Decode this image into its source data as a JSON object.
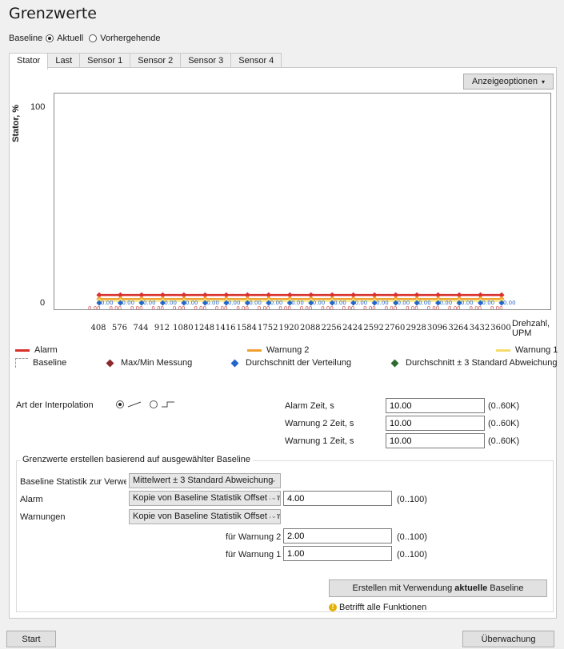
{
  "title": "Grenzwerte",
  "baseline": {
    "label": "Baseline",
    "option_current": "Aktuell",
    "option_previous": "Vorhergehende",
    "selected": "Aktuell"
  },
  "tabs": [
    "Stator",
    "Last",
    "Sensor 1",
    "Sensor 2",
    "Sensor 3",
    "Sensor 4"
  ],
  "active_tab": "Stator",
  "display_options_label": "Anzeigeoptionen",
  "chart_data": {
    "type": "line",
    "ylabel": "Stator, %",
    "xlabel": "Drehzahl, UPM",
    "yticks": [
      "100",
      "0"
    ],
    "ylim": [
      0,
      100
    ],
    "categories": [
      "408",
      "576",
      "744",
      "912",
      "1080",
      "1248",
      "1416",
      "1584",
      "1752",
      "1920",
      "2088",
      "2256",
      "2424",
      "2592",
      "2760",
      "2928",
      "3096",
      "3264",
      "3432",
      "3600"
    ],
    "series": [
      {
        "name": "Alarm",
        "color": "#d9302b",
        "values": [
          4,
          4,
          4,
          4,
          4,
          4,
          4,
          4,
          4,
          4,
          4,
          4,
          4,
          4,
          4,
          4,
          4,
          4,
          4,
          4
        ]
      },
      {
        "name": "Warnung 2",
        "color": "#f0a030",
        "values": [
          2,
          2,
          2,
          2,
          2,
          2,
          2,
          2,
          2,
          2,
          2,
          2,
          2,
          2,
          2,
          2,
          2,
          2,
          2,
          2
        ]
      },
      {
        "name": "Warnung 1",
        "color": "#f5dc6a",
        "values": [
          1,
          1,
          1,
          1,
          1,
          1,
          1,
          1,
          1,
          1,
          1,
          1,
          1,
          1,
          1,
          1,
          1,
          1,
          1,
          1
        ]
      },
      {
        "name": "Durchschnitt der Verteilung",
        "color": "#2266cc",
        "values": [
          0,
          0,
          0,
          0,
          0,
          0,
          0,
          0,
          0,
          0,
          0,
          0,
          0,
          0,
          0,
          0,
          0,
          0,
          0,
          0
        ]
      }
    ],
    "point_labels_blue": "0.00",
    "point_labels_red": "0.00",
    "legend": [
      {
        "name": "Alarm",
        "kind": "line",
        "color": "#d9302b"
      },
      {
        "name": "Warnung 2",
        "kind": "line",
        "color": "#f0a030"
      },
      {
        "name": "Warnung 1",
        "kind": "line",
        "color": "#f5dc6a"
      },
      {
        "name": "Baseline",
        "kind": "dashed",
        "color": "#999999"
      },
      {
        "name": "Max/Min Messung",
        "kind": "diamond",
        "color": "#8b2a2a"
      },
      {
        "name": "Durchschnitt der Verteilung",
        "kind": "diamond",
        "color": "#2266cc"
      },
      {
        "name": "Durchschnitt ± 3 Standard Abweichung",
        "kind": "diamond",
        "color": "#2e6b2e"
      }
    ]
  },
  "interpolation": {
    "label": "Art der Interpolation"
  },
  "times": [
    {
      "label": "Alarm Zeit, s",
      "value": "10.00",
      "range": "(0..60K)"
    },
    {
      "label": "Warnung 2 Zeit, s",
      "value": "10.00",
      "range": "(0..60K)"
    },
    {
      "label": "Warnung 1 Zeit, s",
      "value": "10.00",
      "range": "(0..60K)"
    }
  ],
  "group": {
    "title": "Grenzwerte erstellen basierend auf ausgewählter Baseline",
    "stat_label": "Baseline Statistik zur Verwer",
    "stat_value": "Mittelwert ± 3 Standard Abweichung",
    "alarm_label": "Alarm",
    "alarm_method": "Kopie von Baseline Statistik Offset anwenden, %",
    "alarm_value": "4.00",
    "alarm_range": "(0..100)",
    "warn_label": "Warnungen",
    "warn_method": "Kopie von Baseline Statistik Offset anwenden, %",
    "warn2_label": "für Warnung 2",
    "warn2_value": "2.00",
    "warn2_range": "(0..100)",
    "warn1_label": "für Warnung 1",
    "warn1_value": "1.00",
    "warn1_range": "(0..100)",
    "create_pre": "Erstellen mit Verwendung ",
    "create_bold": "aktuelle",
    "create_post": " Baseline",
    "note": "Betrifft alle Funktionen"
  },
  "footer": {
    "start": "Start",
    "monitor": "Überwachung"
  }
}
